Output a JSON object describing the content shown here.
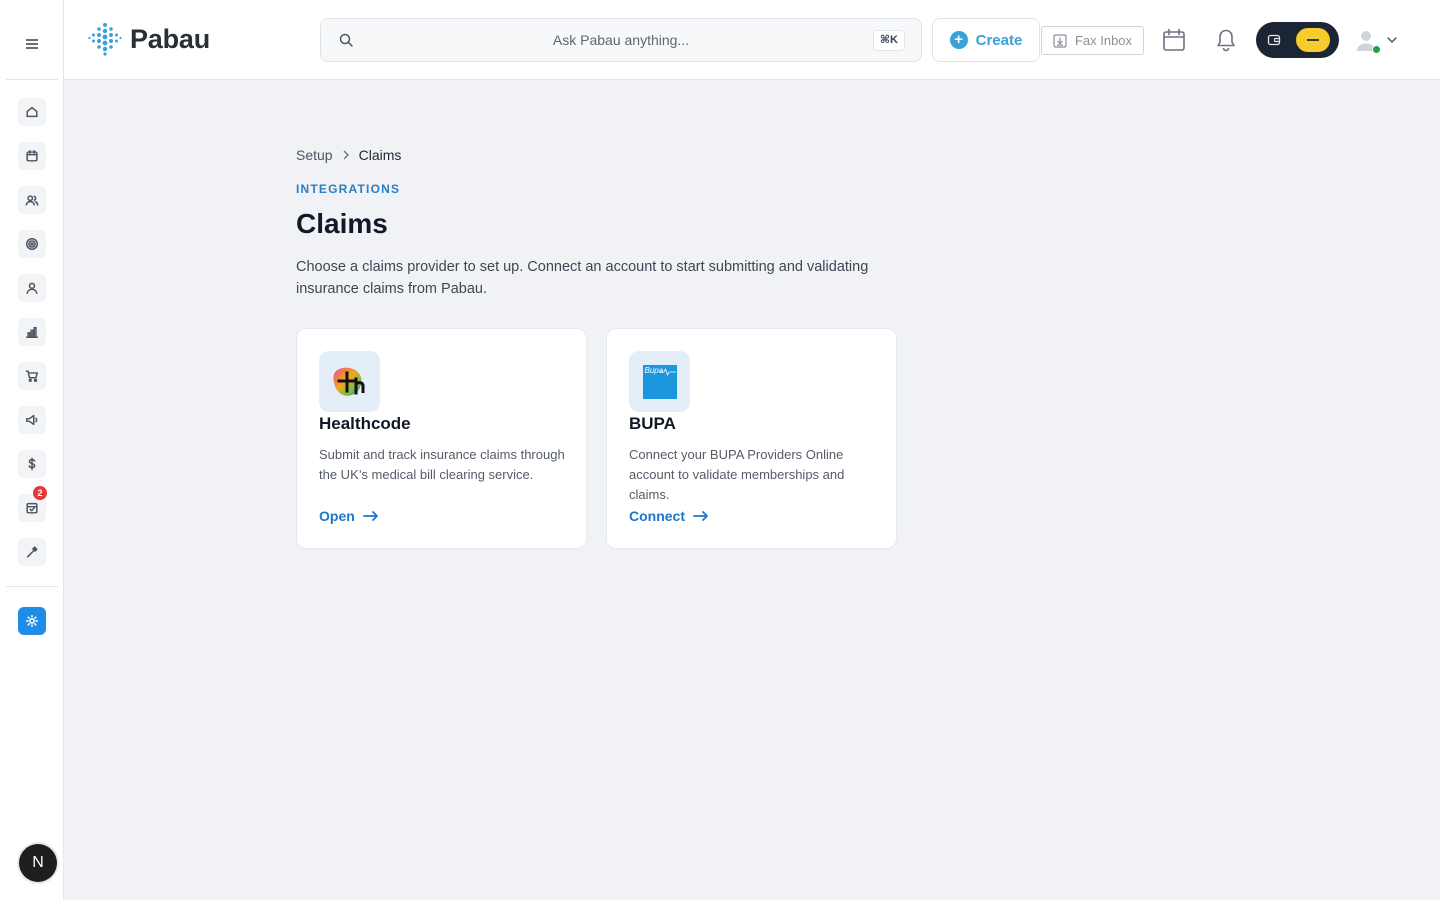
{
  "app": {
    "brand": "Pabau"
  },
  "header": {
    "search_placeholder": "Ask Pabau anything...",
    "search_shortcut": "⌘K",
    "create_label": "Create",
    "fax_label": "Fax Inbox",
    "icons": [
      "calendar-icon",
      "bell-icon",
      "wallet-icon",
      "user-avatar-icon",
      "chevron-down-icon"
    ],
    "toggle_color": "#f6cc2c"
  },
  "sidebar": {
    "items": [
      {
        "icon": "home-icon"
      },
      {
        "icon": "calendar-icon"
      },
      {
        "icon": "contacts-icon"
      },
      {
        "icon": "target-icon"
      },
      {
        "icon": "user-icon"
      },
      {
        "icon": "reports-icon"
      },
      {
        "icon": "cart-icon"
      },
      {
        "icon": "megaphone-icon"
      },
      {
        "icon": "dollar-icon"
      },
      {
        "icon": "inbox-icon",
        "badge": "2"
      },
      {
        "icon": "tools-icon"
      }
    ],
    "settings_icon": "sun-icon",
    "user_initial": "N",
    "accent_color": "#1f8ce6"
  },
  "breadcrumb": {
    "parent": "Setup",
    "current": "Claims"
  },
  "page": {
    "eyebrow": "INTEGRATIONS",
    "title": "Claims",
    "description": "Choose a claims provider to set up. Connect an account to start submitting and validating insurance claims from Pabau."
  },
  "providers": [
    {
      "name": "Healthcode",
      "description": "Submit and track insurance claims through the UK’s medical bill clearing service.",
      "action": "Open"
    },
    {
      "name": "BUPA",
      "logo_text": "Bupa",
      "description": "Connect your BUPA Providers Online account to validate memberships and claims.",
      "action": "Connect"
    }
  ]
}
